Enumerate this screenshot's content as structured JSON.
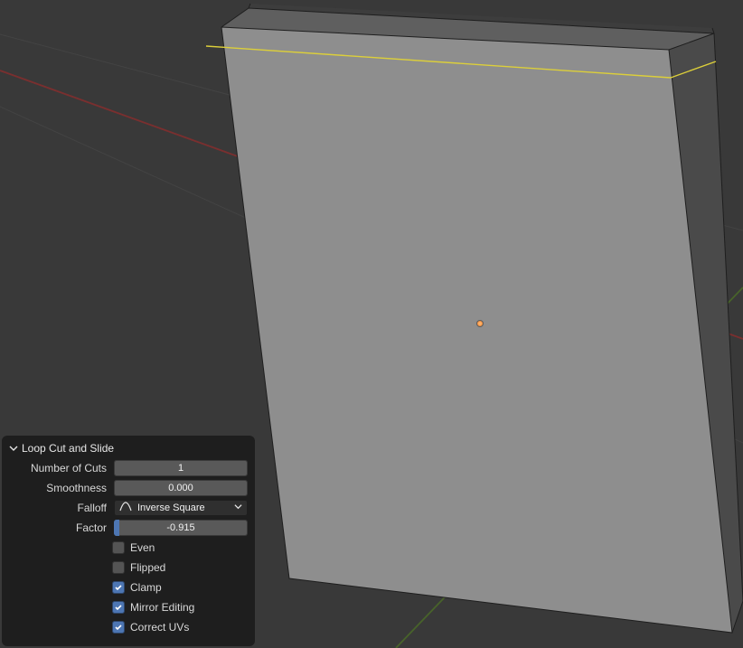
{
  "panel": {
    "title": "Loop Cut and Slide",
    "fields": {
      "number_of_cuts": {
        "label": "Number of Cuts",
        "value": "1"
      },
      "smoothness": {
        "label": "Smoothness",
        "value": "0.000"
      },
      "falloff": {
        "label": "Falloff",
        "value": "Inverse Square"
      },
      "factor": {
        "label": "Factor",
        "value": "-0.915",
        "fill_fraction": 0.04
      }
    },
    "checks": {
      "even": {
        "label": "Even",
        "checked": false
      },
      "flipped": {
        "label": "Flipped",
        "checked": false
      },
      "clamp": {
        "label": "Clamp",
        "checked": true
      },
      "mirror_editing": {
        "label": "Mirror Editing",
        "checked": true
      },
      "correct_uvs": {
        "label": "Correct UVs",
        "checked": true
      }
    }
  },
  "colors": {
    "accent": "#4d76b3",
    "loop_cut": "#dccf3a",
    "axis_x": "#8b3a3a",
    "axis_y": "#4f7e2e"
  }
}
